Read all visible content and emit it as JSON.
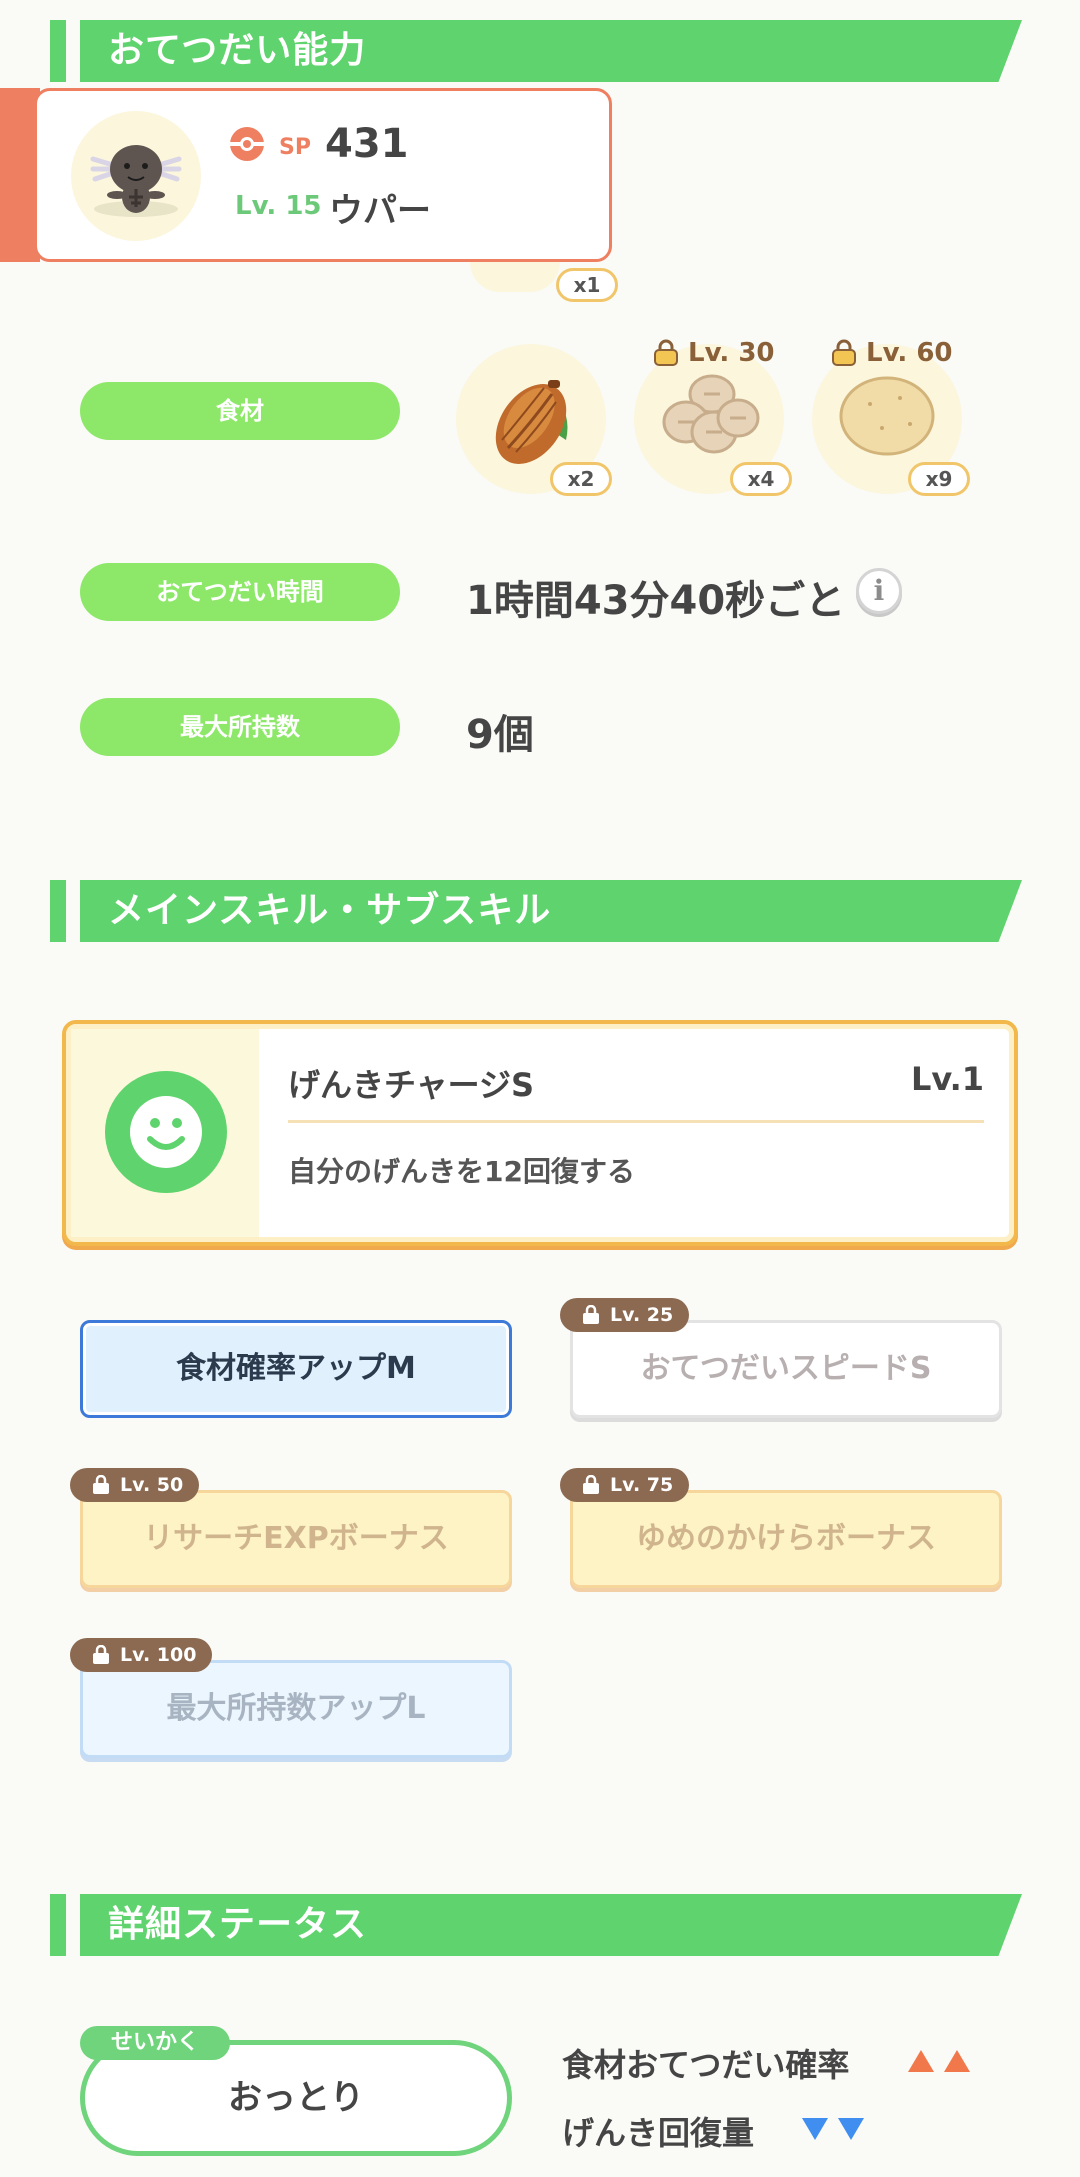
{
  "sections": {
    "helping": "おてつだい能力",
    "skills": "メインスキル・サブスキル",
    "details": "詳細ステータス"
  },
  "pokemon": {
    "sp_label": "SP",
    "sp_value": "431",
    "level": "Lv. 15",
    "name": "ウパー",
    "icon": "wooper-sprite",
    "accent_color": "#ee7f61"
  },
  "peek_badge": "x1",
  "ingredients": {
    "label": "食材",
    "items": [
      {
        "icon": "cacao-icon",
        "qty": "x2",
        "lock": ""
      },
      {
        "icon": "soy-beans-icon",
        "qty": "x4",
        "lock": "Lv. 30"
      },
      {
        "icon": "potato-icon",
        "qty": "x9",
        "lock": "Lv. 60"
      }
    ]
  },
  "help_time": {
    "label": "おてつだい時間",
    "value": "1時間43分40秒ごと",
    "info_glyph": "i"
  },
  "max_carry": {
    "label": "最大所持数",
    "value": "9個"
  },
  "main_skill": {
    "name": "げんきチャージS",
    "level": "Lv.1",
    "description": "自分のげんきを12回復する",
    "icon": "smiley-icon"
  },
  "sub_skills": [
    {
      "label": "食材確率アップM",
      "lock": "",
      "style": "active"
    },
    {
      "label": "おてつだいスピードS",
      "lock": "Lv. 25",
      "style": "grey"
    },
    {
      "label": "リサーチEXPボーナス",
      "lock": "Lv. 50",
      "style": "yellow"
    },
    {
      "label": "ゆめのかけらボーナス",
      "lock": "Lv. 75",
      "style": "yellow"
    },
    {
      "label": "最大所持数アップL",
      "lock": "Lv. 100",
      "style": "blue"
    }
  ],
  "nature": {
    "tag": "せいかく",
    "value": "おっとり",
    "up_label": "食材おてつだい確率",
    "down_label": "げんき回復量",
    "up_color": "#f0784a",
    "down_color": "#3f8ef0"
  },
  "colors": {
    "header_green": "#5fd36d",
    "pill_green": "#8de86a",
    "gold_border": "#f2b84b"
  }
}
